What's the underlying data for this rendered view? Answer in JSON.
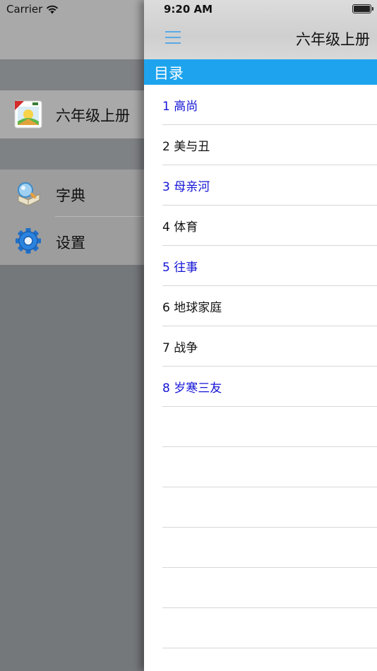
{
  "status_bar": {
    "carrier": "Carrier",
    "time": "9:20 AM"
  },
  "side_menu": {
    "items": [
      {
        "label": "六年级上册",
        "icon": "book-cover-icon"
      },
      {
        "label": "字典",
        "icon": "dictionary-icon"
      },
      {
        "label": "设置",
        "icon": "gear-icon"
      }
    ]
  },
  "header": {
    "title": "六年级上册",
    "menu_icon": "hamburger-icon"
  },
  "section": {
    "title": "目录"
  },
  "lessons": [
    {
      "text": "1 高尚",
      "color": "#1414d6"
    },
    {
      "text": "2 美与丑",
      "color": "#111111"
    },
    {
      "text": "3 母亲河",
      "color": "#1414d6"
    },
    {
      "text": "4 体育",
      "color": "#111111"
    },
    {
      "text": "5 往事",
      "color": "#1414d6"
    },
    {
      "text": "6 地球家庭",
      "color": "#111111"
    },
    {
      "text": "7 战争",
      "color": "#111111"
    },
    {
      "text": "8 岁寒三友",
      "color": "#1414d6"
    }
  ],
  "colors": {
    "accent": "#1ea4ee",
    "link": "#1414d6"
  }
}
